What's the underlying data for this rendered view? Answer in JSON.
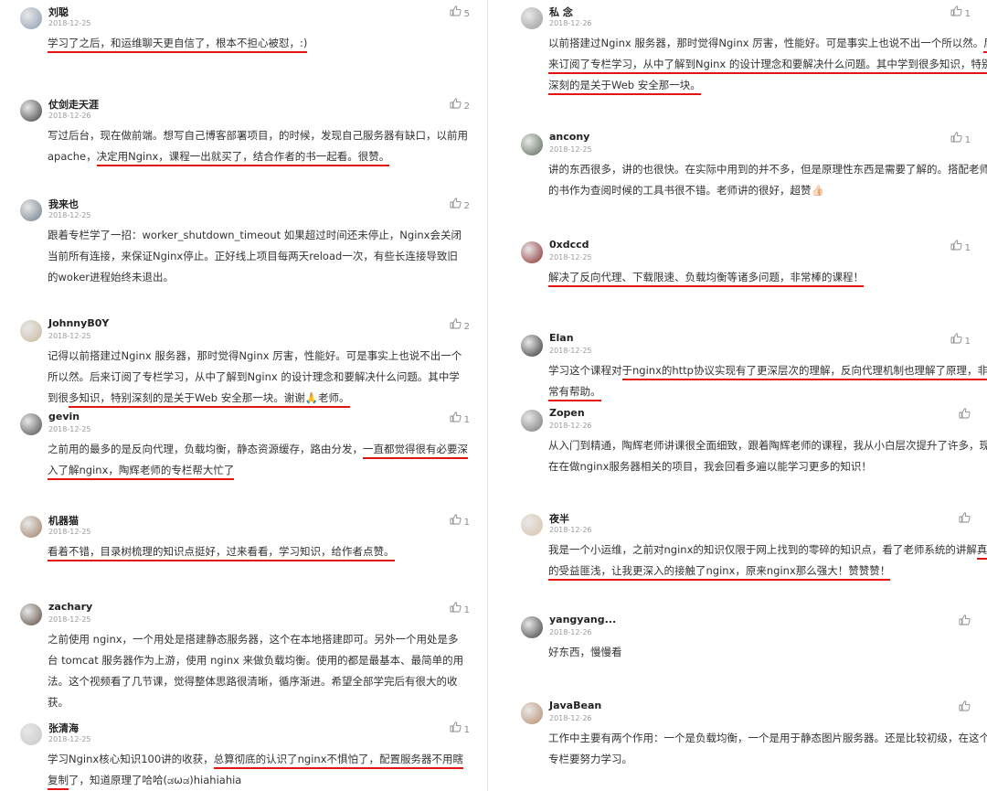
{
  "left": [
    {
      "name": "刘聪",
      "date": "2018-12-25",
      "likes": "5",
      "avatar": "#8a9bb0",
      "segments": [
        {
          "t": "学习了之后，和运维聊天更自信了，根本不担心被怼，:)",
          "u": true
        }
      ]
    },
    {
      "name": "仗剑走天涯",
      "date": "2018-12-26",
      "likes": "2",
      "avatar": "#3a3a3a",
      "segments": [
        {
          "t": "写过后台，现在做前端。想写自己博客部署项目，的时候，发现自己服务器有缺口，以前用apache，",
          "u": false
        },
        {
          "t": "决定用Nginx，课程一出就买了，结合作者的书一起看。很赞。",
          "u": true
        }
      ]
    },
    {
      "name": "我来也",
      "date": "2018-12-25",
      "likes": "2",
      "avatar": "#6e7d8a",
      "segments": [
        {
          "t": "跟着专栏学了一招：worker_shutdown_timeout 如果超过时间还未停止，Nginx会关闭当前所有连接，来保证Nginx停止。正好线上项目每两天reload一次，有些长连接导致旧的woker进程始终未退出。",
          "u": false
        }
      ]
    },
    {
      "name": "JohnnyB0Y",
      "date": "2018-12-25",
      "likes": "2",
      "avatar": "#c9b89a",
      "segments": [
        {
          "t": "记得以前搭建过Nginx 服务器，那时觉得Nginx 厉害，性能好。可是事实上也说不出一个所以然。后来订阅了专栏学习，从中了解到Nginx 的设计理念和要解决什么问题。其中学到很",
          "u": false
        },
        {
          "t": "多知识，特别深刻的是关于Web 安全那一块。谢谢🙏老师。",
          "u": true
        }
      ]
    },
    {
      "name": "gevin",
      "date": "2018-12-25",
      "likes": "1",
      "avatar": "#4a4a4a",
      "segments": [
        {
          "t": "之前用的最多的是反向代理，负载均衡，静态资源缓存，路由分发，",
          "u": false
        },
        {
          "t": "一直都觉得很有必要深入了解nginx，陶辉老师的专栏帮大忙了",
          "u": true
        }
      ]
    },
    {
      "name": "机器猫",
      "date": "2018-12-25",
      "likes": "1",
      "avatar": "#a07f62",
      "segments": [
        {
          "t": "看着不错，目录树梳理的知识点挺好，过来看看，学习知识，给作者点赞。",
          "u": true
        }
      ]
    },
    {
      "name": "zachary",
      "date": "2018-12-25",
      "likes": "1",
      "avatar": "#5b4a3d",
      "segments": [
        {
          "t": "之前使用 nginx，一个用处是搭建静态服务器，这个在本地搭建即可。另外一个用处是多台 tomcat 服务器作为上游，使用 nginx 来做负载均衡。使用的都是最基本、最简单的用法。这个视频看了几节课，觉得整体思路很清晰，循序渐进。希望全部学完后有很大的收获。",
          "u": false
        }
      ]
    },
    {
      "name": "张清海",
      "date": "2018-12-25",
      "likes": "1",
      "avatar": "#c7c7c7",
      "segments": [
        {
          "t": "学习Nginx核心知识100讲的收获，",
          "u": false
        },
        {
          "t": "总算彻底的认识了nginx不惧怕了，配置服务器不用瞎复制",
          "u": true
        },
        {
          "t": "了，知道原理了哈哈(ಡωಡ)hiahiahia",
          "u": false
        }
      ]
    }
  ],
  "right": [
    {
      "name": "私 念",
      "date": "2018-12-26",
      "likes": "1",
      "avatar": "#9a9a9a",
      "segments": [
        {
          "t": "以前搭建过Nginx 服务器，那时觉得Nginx 厉害，性能好。可是事实上也说不出一个所以然。",
          "u": false
        },
        {
          "t": "后来订阅了专栏学习，从中了解到Nginx 的设计理念和要解决什么问题。其中学到很多知识，特别深刻的是关于Web 安全那一块。",
          "u": true
        }
      ]
    },
    {
      "name": "ancony",
      "date": "2018-12-25",
      "likes": "1",
      "avatar": "#556b55",
      "segments": [
        {
          "t": "讲的东西很多，讲的也很快。在实际中用到的并不多，但是原理性东西是需要了解的。搭配老师的书作为查阅时候的工具书很不错。老师讲的很好，超赞👍🏻",
          "u": false
        }
      ]
    },
    {
      "name": "0xdccd",
      "date": "2018-12-25",
      "likes": "1",
      "avatar": "#8a2a2a",
      "segments": [
        {
          "t": "解决了反向代理、下载限速、负载均衡等诸多问题，非常棒的课程！",
          "u": true
        }
      ]
    },
    {
      "name": "Elan",
      "date": "2018-12-25",
      "likes": "1",
      "avatar": "#333333",
      "segments": [
        {
          "t": "学习这个课程对",
          "u": false
        },
        {
          "t": "于nginx的http协议实现有了更深层次的理解，反向代理机制也理解了原理，",
          "u": true
        },
        {
          "t": "非常有帮助。",
          "u": true
        }
      ]
    },
    {
      "name": "Zopen",
      "date": "2018-12-26",
      "likes": "",
      "avatar": "#777777",
      "segments": [
        {
          "t": "从入门到精通，陶辉老师讲课很全面细致，跟着陶辉老师的课程，我从小白层次提升了许多，现在在做nginx服务器相关的项目，我会回看多遍以能学习更多的知识！",
          "u": false
        }
      ]
    },
    {
      "name": "夜半",
      "date": "2018-12-26",
      "likes": "",
      "avatar": "#d8c2a8",
      "segments": [
        {
          "t": "我是一个小运维，之前对nginx的知识仅限于网上找到的零碎的知识点，看了老师系统的讲解",
          "u": false
        },
        {
          "t": "真的受益匪浅，让我更深入的接触了nginx，原来nginx那么强大！赞赞赞！",
          "u": true
        }
      ]
    },
    {
      "name": "yangyang...",
      "date": "2018-12-26",
      "likes": "",
      "avatar": "#3d3d3d",
      "segments": [
        {
          "t": "好东西，慢慢看",
          "u": false
        }
      ]
    },
    {
      "name": "JavaBean",
      "date": "2018-12-26",
      "likes": "",
      "avatar": "#b88a6a",
      "segments": [
        {
          "t": "工作中主要有两个作用：一个是负载均衡，一个是用于静态图片服务器。还是比较初级，在这个专栏要努力学习。",
          "u": false
        }
      ]
    }
  ]
}
